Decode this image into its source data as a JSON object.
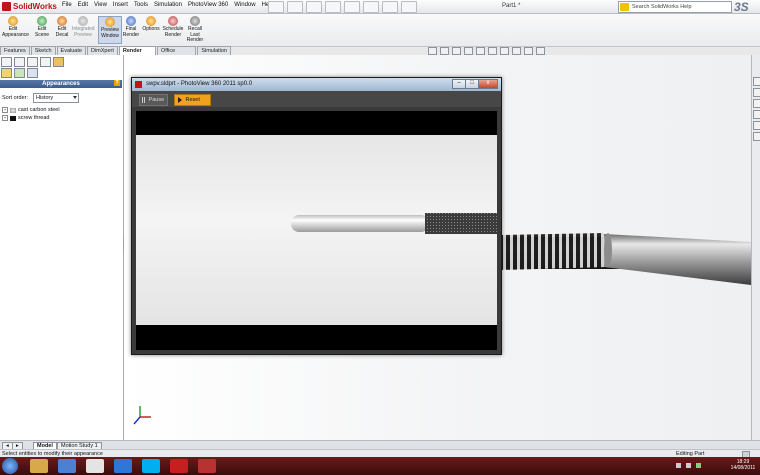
{
  "app": {
    "logo_text": "SolidWorks",
    "doc_title": "Part1 *",
    "help_placeholder": "Search SolidWorks Help"
  },
  "menus": [
    "File",
    "Edit",
    "View",
    "Insert",
    "Tools",
    "Simulation",
    "PhotoView 360",
    "Window",
    "Help"
  ],
  "ribbon": [
    {
      "label": "Edit\nAppearance",
      "state": "normal"
    },
    {
      "label": "Edit\nScene",
      "state": "normal"
    },
    {
      "label": "Edit\nDecal",
      "state": "normal"
    },
    {
      "label": "Integrated\nPreview",
      "state": "dim"
    },
    {
      "label": "Preview\nWindow",
      "state": "selected"
    },
    {
      "label": "Final\nRender",
      "state": "normal"
    },
    {
      "label": "Options",
      "state": "normal"
    },
    {
      "label": "Schedule\nRender",
      "state": "normal"
    },
    {
      "label": "Recall\nLast\nRender",
      "state": "normal"
    }
  ],
  "tabs": [
    "Features",
    "Sketch",
    "Evaluate",
    "DimXpert",
    "Render Tools",
    "Office Products",
    "Simulation"
  ],
  "active_tab": "Render Tools",
  "left_panel": {
    "header": "Appearances",
    "help": "?",
    "sort_label": "Sort order:",
    "sort_value": "History",
    "items": [
      {
        "label": "cast carbon steel"
      },
      {
        "label": "screw thread"
      }
    ]
  },
  "photoview": {
    "title": "swpv.sldprt - PhotoView 360 2011 sp0.0",
    "pause": "Pause",
    "reset": "Reset",
    "min": "–",
    "max": "□",
    "close": "x"
  },
  "bottom_tabs": [
    "Model",
    "Motion Study 1"
  ],
  "status": {
    "left": "Select entities to modify their appearance",
    "mode": "Editing Part"
  },
  "clock": {
    "time": "18:29",
    "date": "14/08/2011"
  },
  "colors": {
    "accent_orange": "#f1a21c",
    "title_blue": "#3c5c8c",
    "taskbar": "#4a0f0f",
    "logo_red": "#c0121c"
  }
}
